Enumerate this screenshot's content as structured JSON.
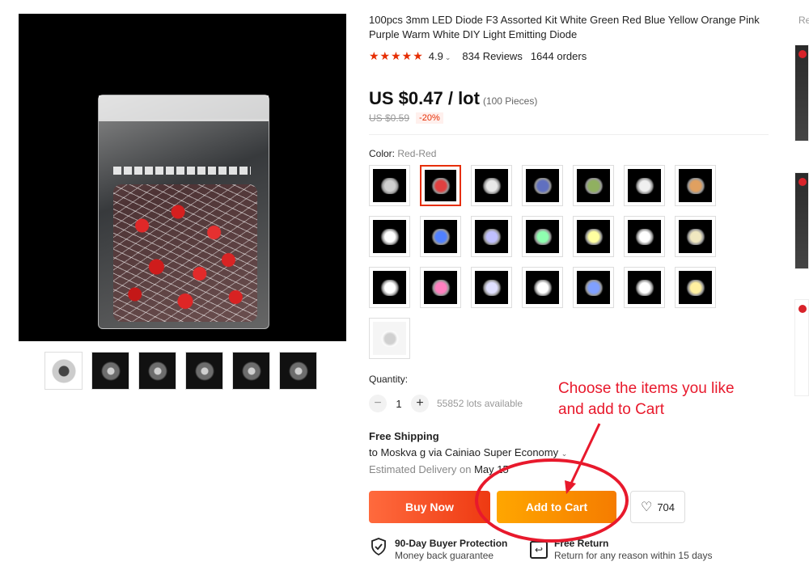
{
  "product": {
    "title": "100pcs 3mm LED Diode F3 Assorted Kit White Green Red Blue Yellow Orange Pink Purple Warm White DIY Light Emitting Diode",
    "rating": "4.9",
    "reviews": "834 Reviews",
    "orders": "1644 orders",
    "stars": "★★★★★",
    "price": "US $0.47 / lot",
    "price_note": "(100 Pieces)",
    "old_price": "US $0.59",
    "discount": "-20%"
  },
  "color": {
    "label": "Color:",
    "selected": "Red-Red",
    "swatch_tints": [
      "#cfcfcf",
      "#e04040",
      "#e8e8e8",
      "#6070c0",
      "#90b060",
      "#f0f0f0",
      "#e0a060",
      "#ffffff",
      "#5080ff",
      "#c0c0ff",
      "#8fffb0",
      "#ffffa0",
      "#ffffff",
      "#f0e8c0",
      "#ffffff",
      "#ff80c0",
      "#e0e0ff",
      "#ffffff",
      "#80a0ff",
      "#ffffff",
      "#fff0a0",
      "#d0d0d0"
    ]
  },
  "quantity": {
    "label": "Quantity:",
    "minus": "−",
    "plus": "+",
    "value": "1",
    "available": "55852 lots available"
  },
  "shipping": {
    "title": "Free Shipping",
    "destination": "to Moskva g via Cainiao Super Economy",
    "estimated_label": "Estimated Delivery on",
    "estimated_date": "May 15"
  },
  "actions": {
    "buy_now": "Buy Now",
    "add_to_cart": "Add to Cart",
    "wishlist_count": "704"
  },
  "protection": {
    "title": "90-Day Buyer Protection",
    "subtitle": "Money back guarantee",
    "return_title": "Free Return",
    "return_subtitle": "Return for any reason within 15 days"
  },
  "annotation": {
    "line1": "Choose the items you like",
    "line2": "and add to Cart"
  },
  "sidebar": {
    "label": "Re"
  },
  "colors": {
    "accent": "#e62e04",
    "cart": "#f7931e",
    "annotation": "#e8192c"
  }
}
